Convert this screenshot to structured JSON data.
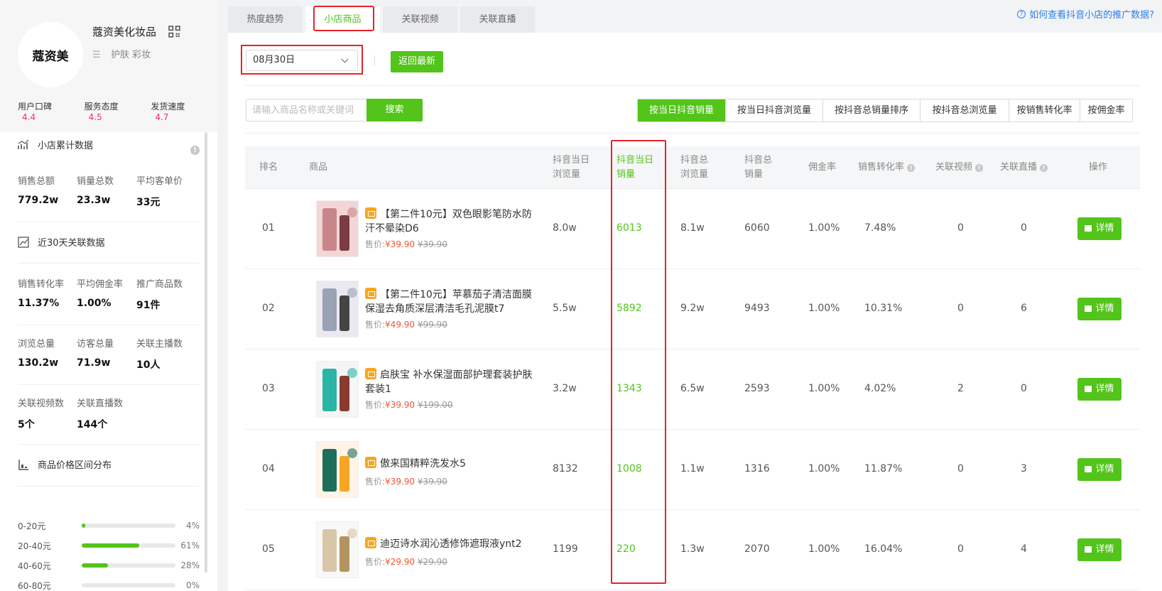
{
  "shop": {
    "logo_text": "蔻资美",
    "name": "蔻资美化妆品",
    "categories": "护肤 彩妆",
    "ratings": [
      {
        "label": "用户口碑",
        "value": "4.4"
      },
      {
        "label": "服务态度",
        "value": "4.5"
      },
      {
        "label": "发货速度",
        "value": "4.7"
      }
    ]
  },
  "sidebar": {
    "cumulative_title": "小店累计数据",
    "cumulative": [
      {
        "label": "销售总额",
        "value": "779.2w"
      },
      {
        "label": "销量总数",
        "value": "23.3w"
      },
      {
        "label": "平均客单价",
        "value": "33元"
      }
    ],
    "recent_title": "近30天关联数据",
    "recent_row1": [
      {
        "label": "销售转化率",
        "value": "11.37%"
      },
      {
        "label": "平均佣金率",
        "value": "1.00%"
      },
      {
        "label": "推广商品数",
        "value": "91件"
      }
    ],
    "recent_row2": [
      {
        "label": "浏览总量",
        "value": "130.2w"
      },
      {
        "label": "访客总量",
        "value": "71.9w"
      },
      {
        "label": "关联主播数",
        "value": "10人"
      }
    ],
    "recent_row3": [
      {
        "label": "关联视频数",
        "value": "5个"
      },
      {
        "label": "关联直播数",
        "value": "144个"
      }
    ],
    "price_title": "商品价格区间分布",
    "price_ranges": [
      {
        "range": "0-20元",
        "pct_text": "4%",
        "pct": 4
      },
      {
        "range": "20-40元",
        "pct_text": "61%",
        "pct": 61
      },
      {
        "range": "40-60元",
        "pct_text": "28%",
        "pct": 28
      },
      {
        "range": "60-80元",
        "pct_text": "0%",
        "pct": 0
      }
    ]
  },
  "tabs": [
    "热度趋势",
    "小店商品",
    "关联视频",
    "关联直播"
  ],
  "active_tab": 1,
  "help_link": "如何查看抖音小店的推广数据?",
  "filters": {
    "date": "08月30日",
    "latest_label": "返回最新",
    "search_placeholder": "请输入商品名称或关键词",
    "search_label": "搜索",
    "sorts": [
      "按当日抖音销量",
      "按当日抖音浏览量",
      "按抖音总销量排序",
      "按抖音总浏览量",
      "按销售转化率",
      "按佣金率"
    ],
    "active_sort": 0
  },
  "table": {
    "headers": {
      "rank": "排名",
      "product": "商品",
      "daily_views_1": "抖音当日",
      "daily_views_2": "浏览量",
      "daily_sales_1": "抖音当日",
      "daily_sales_2": "销量",
      "total_views_1": "抖音总",
      "total_views_2": "浏览量",
      "total_sales_1": "抖音总",
      "total_sales_2": "销量",
      "commission": "佣金率",
      "conversion": "销售转化率",
      "videos": "关联视频",
      "lives": "关联直播",
      "action": "操作"
    },
    "price_prefix": "售价:",
    "detail_label": "详情",
    "rows": [
      {
        "rank": "01",
        "name": "【第二件10元】双色眼影笔防水防汗不晕染D6",
        "price": "¥39.90",
        "old_price": "¥39.90",
        "daily_views": "8.0w",
        "daily_sales": "6013",
        "total_views": "8.1w",
        "total_sales": "6060",
        "commission": "1.00%",
        "conversion": "7.48%",
        "videos": "0",
        "lives": "0"
      },
      {
        "rank": "02",
        "name": "【第二件10元】苹慕茄子清洁面膜保湿去角质深层清洁毛孔泥膜t7",
        "price": "¥49.90",
        "old_price": "¥99.90",
        "daily_views": "5.5w",
        "daily_sales": "5892",
        "total_views": "9.2w",
        "total_sales": "9493",
        "commission": "1.00%",
        "conversion": "10.31%",
        "videos": "0",
        "lives": "6"
      },
      {
        "rank": "03",
        "name": "启肤宝 补水保湿面部护理套装护肤套装1",
        "price": "¥39.90",
        "old_price": "¥199.00",
        "daily_views": "3.2w",
        "daily_sales": "1343",
        "total_views": "6.5w",
        "total_sales": "2593",
        "commission": "1.00%",
        "conversion": "4.02%",
        "videos": "2",
        "lives": "0"
      },
      {
        "rank": "04",
        "name": "傲来国精粹洗发水5",
        "price": "¥39.90",
        "old_price": "¥39.90",
        "daily_views": "8132",
        "daily_sales": "1008",
        "total_views": "1.1w",
        "total_sales": "1316",
        "commission": "1.00%",
        "conversion": "11.87%",
        "videos": "0",
        "lives": "3"
      },
      {
        "rank": "05",
        "name": "迪迈诗水润沁透修饰遮瑕液ynt2",
        "price": "¥29.90",
        "old_price": "¥29.90",
        "daily_views": "1199",
        "daily_sales": "220",
        "total_views": "1.3w",
        "total_sales": "2070",
        "commission": "1.00%",
        "conversion": "16.04%",
        "videos": "0",
        "lives": "4"
      }
    ]
  },
  "colors": {
    "accent": "#52c41a",
    "highlight": "#e8222c",
    "price": "#f5542f",
    "link": "#2d7fe6",
    "rating": "#f0325d"
  }
}
